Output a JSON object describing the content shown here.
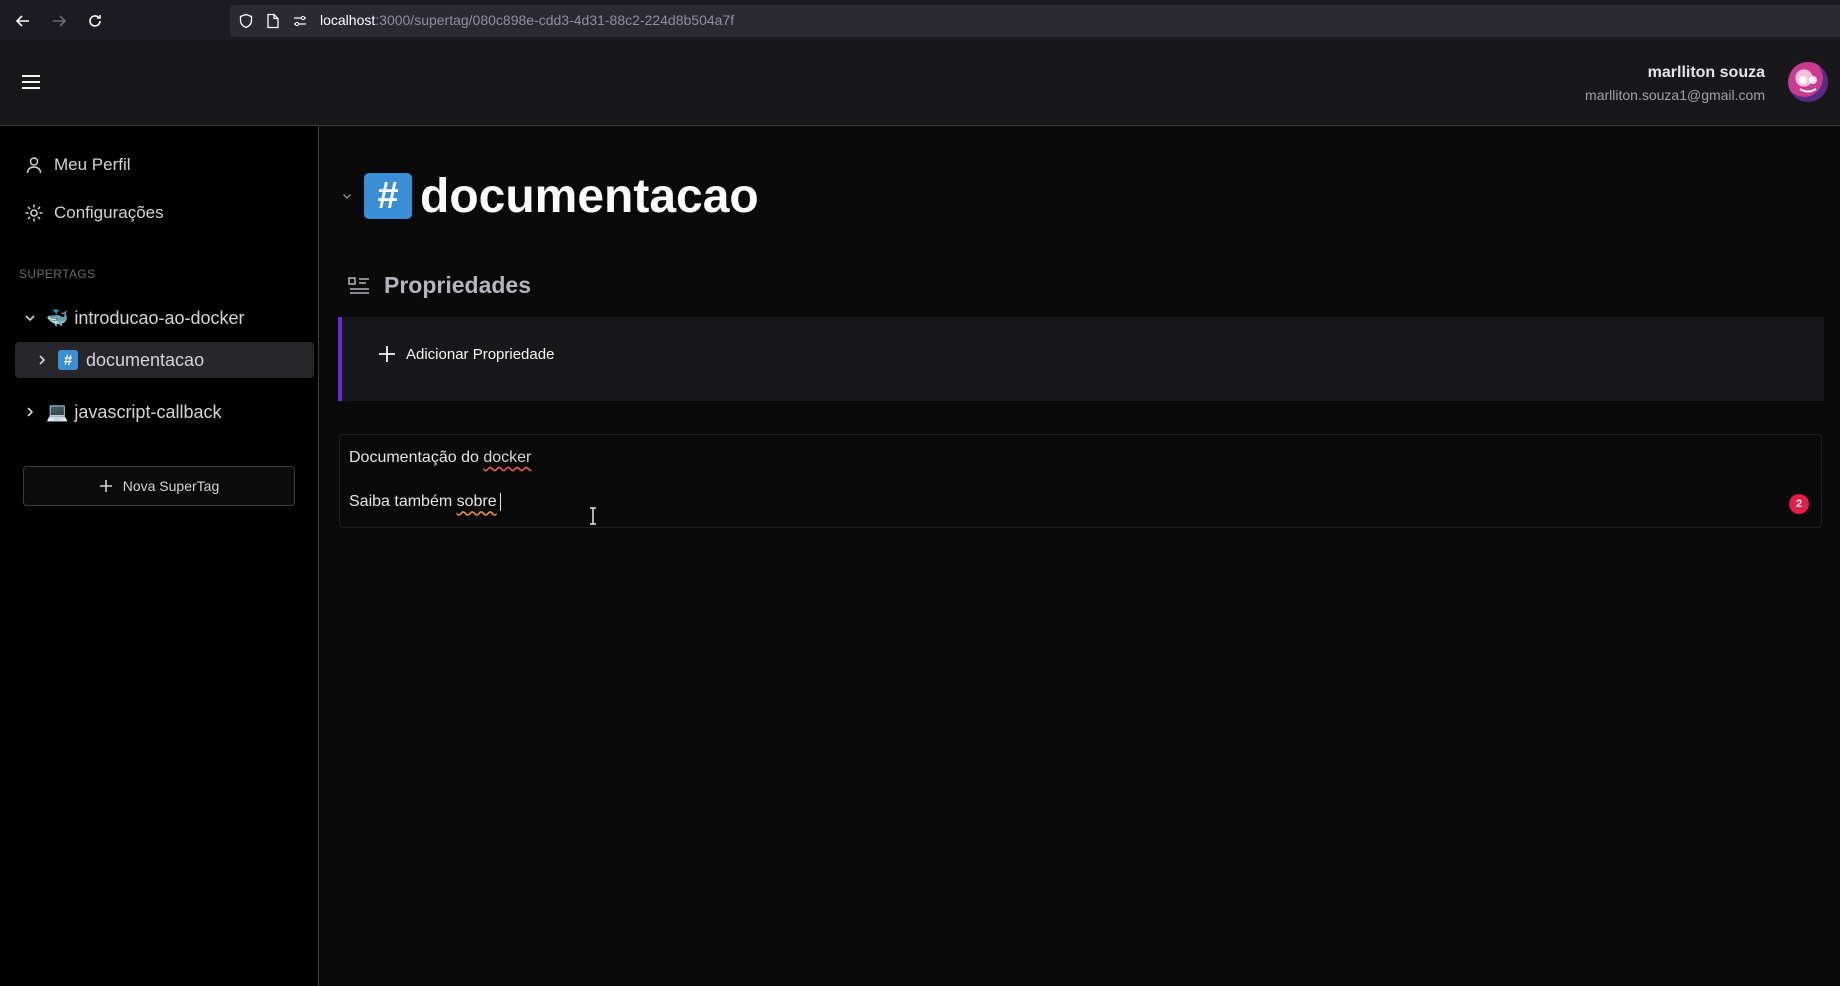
{
  "browser": {
    "url_host": "localhost",
    "url_path": ":3000/supertag/080c898e-cdd3-4d31-88c2-224d8b504a7f"
  },
  "header": {
    "user_name": "marlliton souza",
    "user_email": "marlliton.souza1@gmail.com"
  },
  "sidebar": {
    "profile_label": "Meu Perfil",
    "settings_label": "Configurações",
    "section_label": "SUPERTAGS",
    "tree": [
      {
        "emoji": "🐳",
        "label": "introducao-ao-docker",
        "expanded": true
      },
      {
        "emoji": "#",
        "label": "documentacao",
        "active": true
      },
      {
        "emoji": "💻",
        "label": "javascript-callback",
        "expanded": false
      }
    ],
    "new_tag_label": "Nova SuperTag"
  },
  "main": {
    "title_icon": "#",
    "title": "documentacao",
    "properties_title": "Propriedades",
    "add_property_label": "Adicionar Propriedade",
    "editor": {
      "line1_text": "Documentação do ",
      "line1_link": "docker",
      "line2_text": "Saiba também ",
      "line2_link": "sobre",
      "error_count": "2"
    }
  },
  "colors": {
    "accent_purple": "#6d28d9",
    "hash_blue": "#3a8ed6",
    "error_red": "#e11d48"
  }
}
